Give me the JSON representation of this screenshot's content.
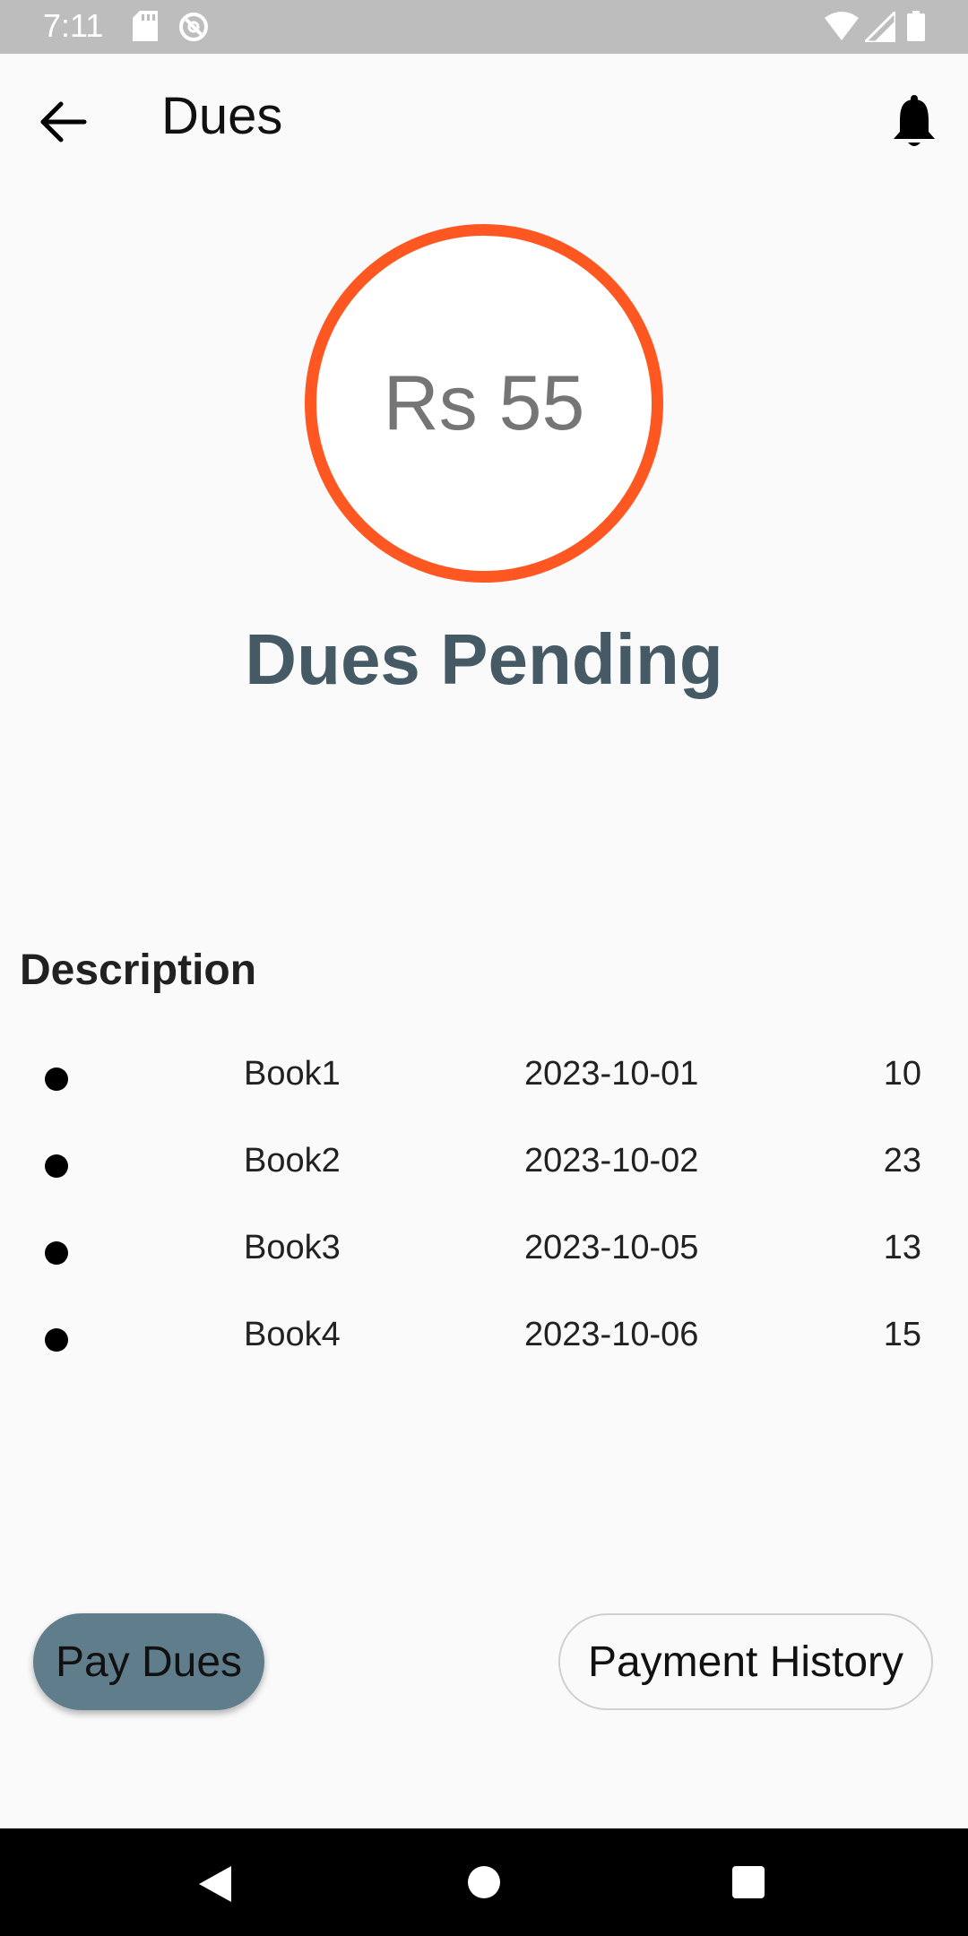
{
  "status_bar": {
    "time": "7:11",
    "icons": [
      "sd-card-icon",
      "no-sync-icon",
      "wifi-icon",
      "signal-icon",
      "battery-icon"
    ]
  },
  "app_bar": {
    "title": "Dues",
    "back_icon": "arrow-back-icon",
    "bell_icon": "bell-icon"
  },
  "summary": {
    "amount": "Rs 55",
    "status": "Dues Pending",
    "ring_color": "#ff5722",
    "status_color": "#455a64"
  },
  "description": {
    "title": "Description",
    "items": [
      {
        "title": "Book1",
        "date": "2023-10-01",
        "amount": "10"
      },
      {
        "title": "Book2",
        "date": "2023-10-02",
        "amount": "23"
      },
      {
        "title": "Book3",
        "date": "2023-10-05",
        "amount": "13"
      },
      {
        "title": "Book4",
        "date": "2023-10-06",
        "amount": "15"
      }
    ]
  },
  "actions": {
    "pay_label": "Pay Dues",
    "history_label": "Payment History",
    "pay_color": "#607d8b"
  },
  "nav_bar": {
    "icons": [
      "nav-back-icon",
      "nav-home-icon",
      "nav-recents-icon"
    ]
  }
}
